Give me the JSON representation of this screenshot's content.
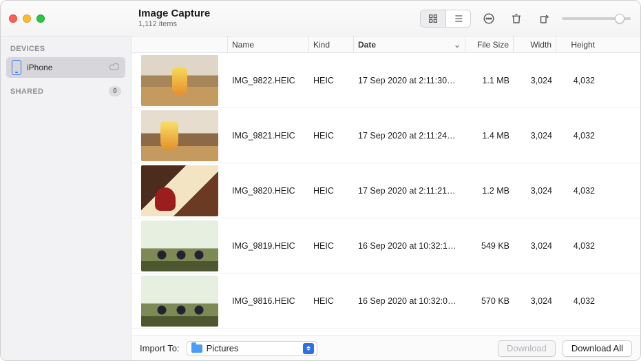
{
  "app": {
    "title": "Image Capture",
    "item_count": "1,112 items"
  },
  "toolbar": {
    "view_grid": "grid",
    "view_list": "list",
    "active_view": "grid",
    "more": "more",
    "delete": "delete",
    "rotate": "rotate",
    "thumbnail_size": 90
  },
  "sidebar": {
    "sections": [
      {
        "title": "DEVICES",
        "items": [
          {
            "label": "iPhone",
            "icon": "iphone",
            "cloud": true,
            "selected": true
          }
        ]
      },
      {
        "title": "SHARED",
        "count": "0",
        "items": []
      }
    ]
  },
  "columns": {
    "name": "Name",
    "kind": "Kind",
    "date": "Date",
    "file_size": "File Size",
    "width": "Width",
    "height": "Height",
    "sort_column": "date",
    "sort_dir": "desc"
  },
  "rows": [
    {
      "thumb": "t0",
      "name": "IMG_9822.HEIC",
      "kind": "HEIC",
      "date": "17 Sep 2020  at 2:11:30…",
      "size": "1.1 MB",
      "w": "3,024",
      "h": "4,032"
    },
    {
      "thumb": "t1",
      "name": "IMG_9821.HEIC",
      "kind": "HEIC",
      "date": "17 Sep 2020  at 2:11:24…",
      "size": "1.4 MB",
      "w": "3,024",
      "h": "4,032"
    },
    {
      "thumb": "t2",
      "name": "IMG_9820.HEIC",
      "kind": "HEIC",
      "date": "17 Sep 2020  at 2:11:21…",
      "size": "1.2 MB",
      "w": "3,024",
      "h": "4,032"
    },
    {
      "thumb": "t3",
      "name": "IMG_9819.HEIC",
      "kind": "HEIC",
      "date": "16 Sep 2020  at 10:32:1…",
      "size": "549 KB",
      "w": "3,024",
      "h": "4,032"
    },
    {
      "thumb": "t4",
      "name": "IMG_9816.HEIC",
      "kind": "HEIC",
      "date": "16 Sep 2020  at 10:32:0…",
      "size": "570 KB",
      "w": "3,024",
      "h": "4,032"
    }
  ],
  "footer": {
    "import_to_label": "Import To:",
    "destination": "Pictures",
    "download": "Download",
    "download_all": "Download All",
    "download_enabled": false
  }
}
